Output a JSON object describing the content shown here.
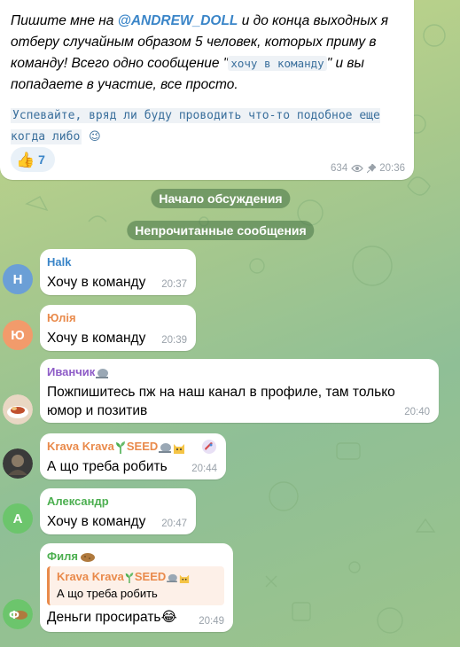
{
  "colors": {
    "accent": "#3a85c8",
    "name_halk": "#3a85c8",
    "name_yulia": "#e98a4b",
    "name_ivanchik": "#8e5cc7",
    "name_krava": "#e98a4b",
    "name_aleksandr": "#4caf50",
    "name_filya": "#4caf50"
  },
  "post": {
    "text_before": "Пишите мне на ",
    "mention": "@ANDREW_DOLL",
    "text_after_mention": " и до конца выходных я отберу случайным образом 5 человек, которых приму в команду! Всего одно сообщение \"",
    "code": "хочу в команду",
    "text_end": "\" и вы попадаете в участие, все просто.",
    "mono_line": "Успевайте, вряд ли буду проводить что-то подобное еще когда либо",
    "mono_emoji": "😉",
    "reaction_emoji": "👍",
    "reaction_count": "7",
    "views": "634",
    "time": "20:36"
  },
  "service": {
    "discussion_start": "Начало обсуждения",
    "unread": "Непрочитанные сообщения"
  },
  "messages": [
    {
      "avatar_letter": "H",
      "name": "Halk",
      "text": "Хочу в команду",
      "time": "20:37"
    },
    {
      "avatar_letter": "Ю",
      "name": "Юлія",
      "text": "Хочу в команду",
      "time": "20:39"
    },
    {
      "name": "Иванчик",
      "text": "Пожпишитесь пж на наш канал в профиле, там только юмор и позитив",
      "time": "20:40"
    },
    {
      "name": "Krava Krava",
      "name_suffix": "SEED",
      "text": "А що треба робить",
      "time": "20:44"
    },
    {
      "avatar_letter": "А",
      "name": "Александр",
      "text": "Хочу в команду",
      "time": "20:47"
    },
    {
      "name": "Филя",
      "reply_name": "Krava Krava",
      "reply_suffix": "SEED",
      "reply_text": "А що треба робить",
      "text": "Деньги просирать",
      "text_emoji": "😂",
      "time": "20:49"
    }
  ]
}
